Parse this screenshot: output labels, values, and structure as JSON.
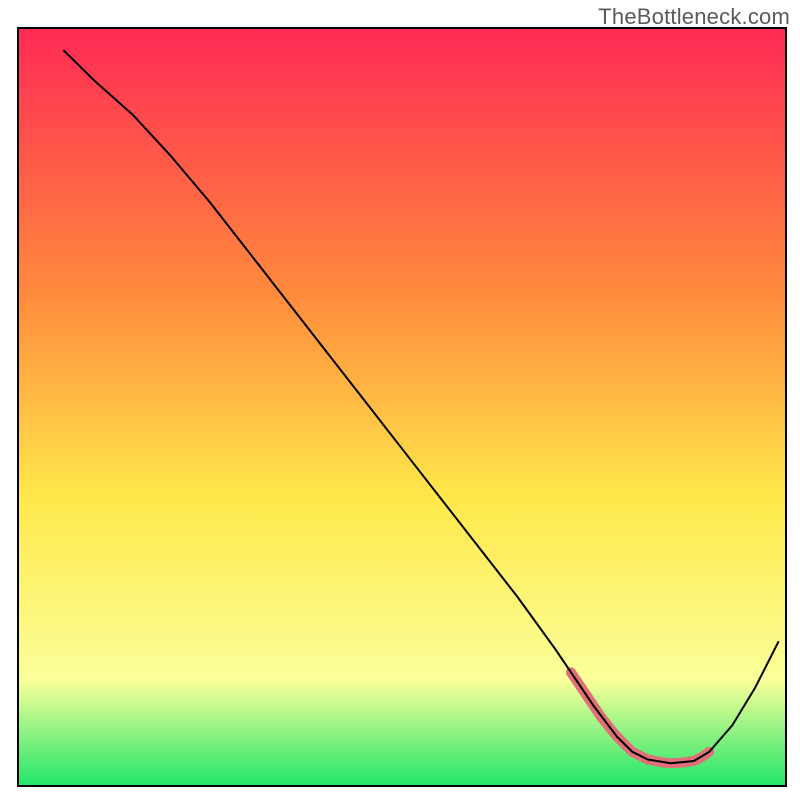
{
  "watermark": "TheBottleneck.com",
  "chart_data": {
    "type": "line",
    "title": "",
    "xlabel": "",
    "ylabel": "",
    "xlim": [
      0,
      100
    ],
    "ylim": [
      0,
      100
    ],
    "grid": false,
    "legend": false,
    "background_gradient": {
      "top": "#ff2a55",
      "mid1": "#ff8a3d",
      "mid2": "#ffe84a",
      "mid3": "#faff9a",
      "bottom": "#20e66a"
    },
    "series": [
      {
        "name": "curve",
        "stroke": "#000000",
        "stroke_width": 2,
        "x": [
          6,
          10,
          15,
          20,
          25,
          30,
          35,
          40,
          45,
          50,
          55,
          60,
          65,
          70,
          72,
          75,
          78,
          80,
          82,
          85,
          88,
          90,
          93,
          96,
          99
        ],
        "values": [
          97,
          93,
          88.5,
          83,
          77,
          70.5,
          64,
          57.5,
          51,
          44.5,
          38,
          31.5,
          25,
          18,
          15,
          10.5,
          6.5,
          4.5,
          3.5,
          3,
          3.3,
          4.5,
          8,
          13,
          19
        ]
      },
      {
        "name": "marker-band",
        "stroke": "#e06f78",
        "stroke_width": 10,
        "linecap": "round",
        "x": [
          72,
          74,
          76,
          78,
          80,
          82,
          84,
          85,
          86,
          87,
          88,
          89,
          90
        ],
        "values": [
          15,
          12,
          9,
          6.5,
          4.5,
          3.5,
          3.1,
          3.0,
          3.05,
          3.15,
          3.3,
          3.8,
          4.5
        ]
      }
    ]
  }
}
